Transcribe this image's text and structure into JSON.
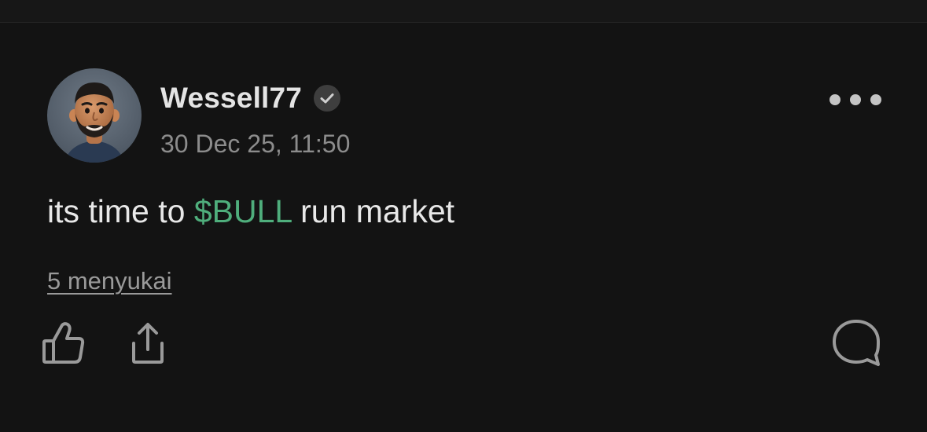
{
  "post": {
    "username": "Wessell77",
    "timestamp": "30 Dec 25, 11:50",
    "text_before": "its time to ",
    "cashtag": "$BULL",
    "text_after": " run market",
    "likes_label": "5 menyukai"
  },
  "icons": {
    "avatar": "avatar-3d-bearded-man",
    "verified": "verified-check-icon",
    "more": "more-dots-icon",
    "like": "thumbs-up-icon",
    "share": "share-icon",
    "comment": "comment-bubble-icon"
  },
  "colors": {
    "background": "#131313",
    "cashtag": "#4fae7c",
    "muted_text": "#8c8c8c",
    "icon": "#9a9a9a"
  }
}
